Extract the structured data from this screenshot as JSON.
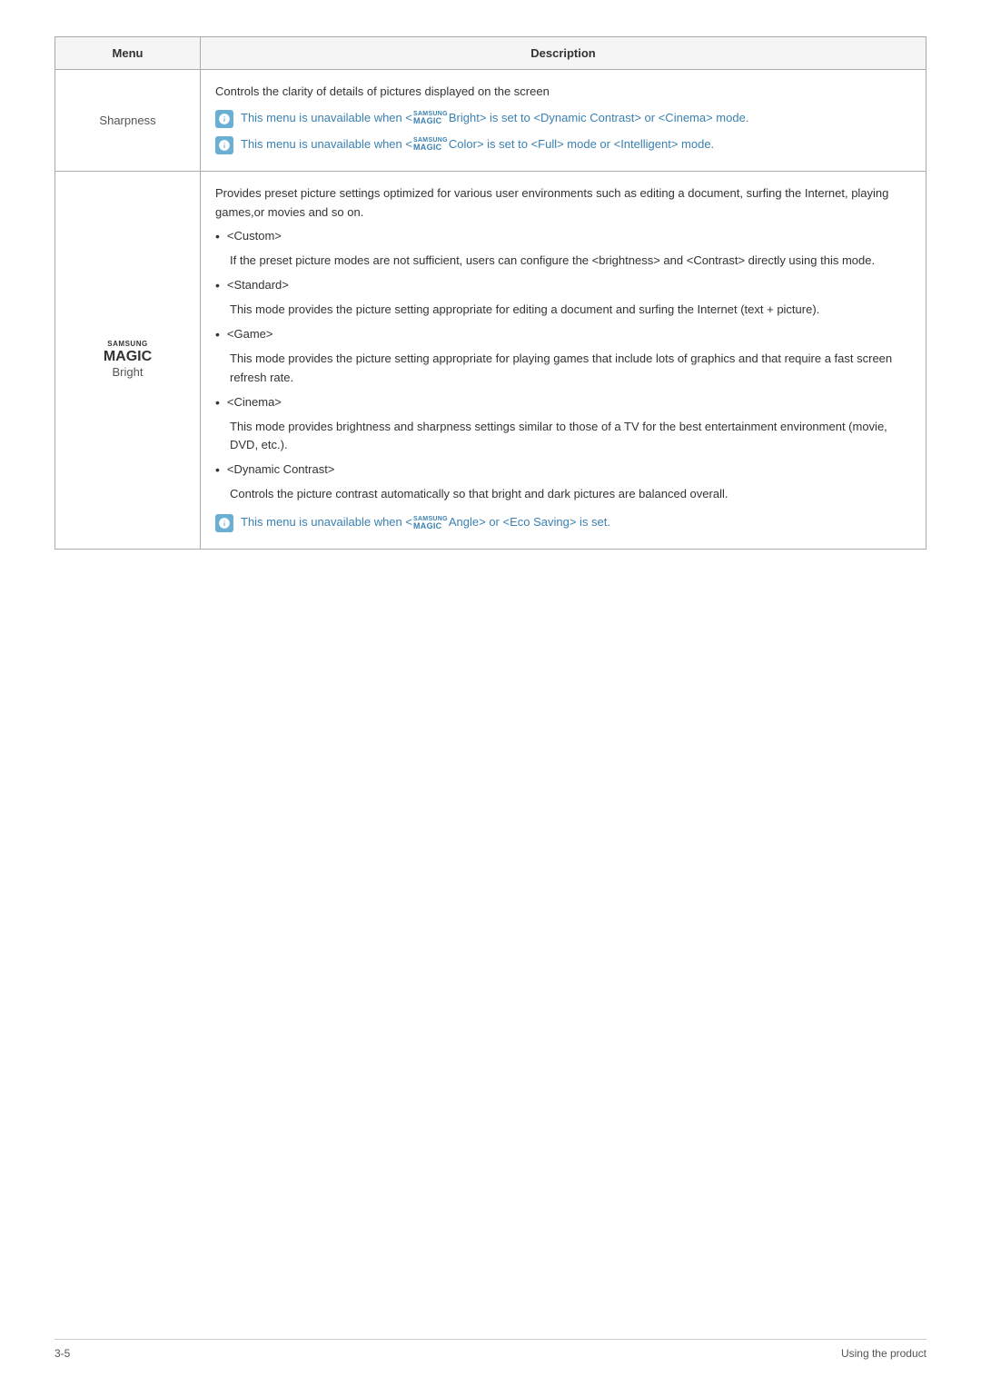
{
  "header": {
    "col1": "Menu",
    "col2": "Description"
  },
  "rows": [
    {
      "menu": "Sharpness",
      "type": "sharpness",
      "description": {
        "intro": "Controls the clarity of details of pictures displayed on the screen",
        "notes": [
          {
            "text": "This menu is unavailable when <MAGIC>Bright> is set to <Dynamic Contrast> or <Cinema> mode.",
            "type": "bright"
          },
          {
            "text": "This menu is unavailable when <MAGIC>Color> is set to <Full> mode or <Intelligent> mode.",
            "type": "color"
          }
        ]
      }
    },
    {
      "menu": "MAGICBright",
      "type": "magic-bright",
      "description": {
        "intro": "Provides preset picture settings optimized for various user environments such as editing a document, surfing the Internet, playing games,or movies and so on.",
        "items": [
          {
            "label": "<Custom>",
            "detail": "If the preset picture modes are not sufficient, users can configure the <brightness> and <Contrast> directly using this mode."
          },
          {
            "label": "<Standard>",
            "detail": "This mode provides the picture setting appropriate for editing a document and surfing the Internet (text + picture)."
          },
          {
            "label": "<Game>",
            "detail": "This mode provides the picture setting appropriate for playing games that include lots of graphics and that require a fast screen refresh rate."
          },
          {
            "label": "<Cinema>",
            "detail": "This mode provides brightness and sharpness settings similar to those of a TV for the best entertainment environment (movie, DVD, etc.)."
          },
          {
            "label": "<Dynamic Contrast>",
            "detail": "Controls the picture contrast automatically so that bright and dark pictures are balanced overall."
          }
        ],
        "note": {
          "text": "This menu is unavailable when <MAGIC>Angle> or <Eco Saving> is set.",
          "type": "angle"
        }
      }
    }
  ],
  "footer": {
    "left": "3-5",
    "right": "Using the product"
  }
}
